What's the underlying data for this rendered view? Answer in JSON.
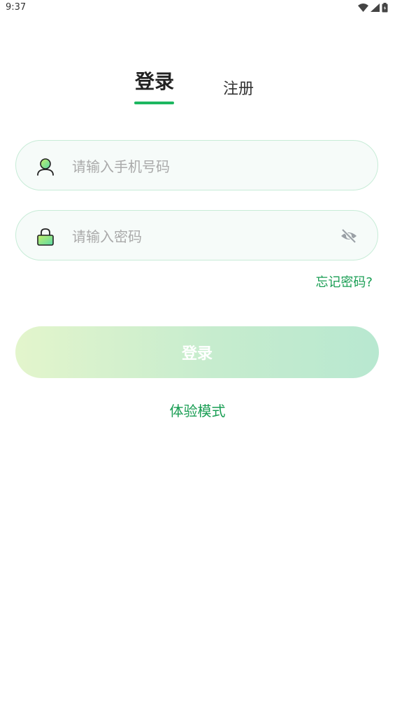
{
  "status_bar": {
    "time": "9:37",
    "icons": [
      "wifi-icon",
      "signal-icon",
      "battery-icon"
    ]
  },
  "tabs": {
    "login_label": "登录",
    "register_label": "注册",
    "active": "login"
  },
  "phone_field": {
    "placeholder": "请输入手机号码",
    "value": "",
    "icon": "user-icon"
  },
  "password_field": {
    "placeholder": "请输入密码",
    "value": "",
    "icon": "lock-icon",
    "toggle_icon": "eye-off-icon"
  },
  "forgot_password_label": "忘记密码?",
  "login_button_label": "登录",
  "trial_mode_label": "体验模式",
  "colors": {
    "accent": "#1db760",
    "link": "#1a9e54",
    "field_border": "#c7ecd7",
    "field_bg": "#f6fbf9"
  }
}
